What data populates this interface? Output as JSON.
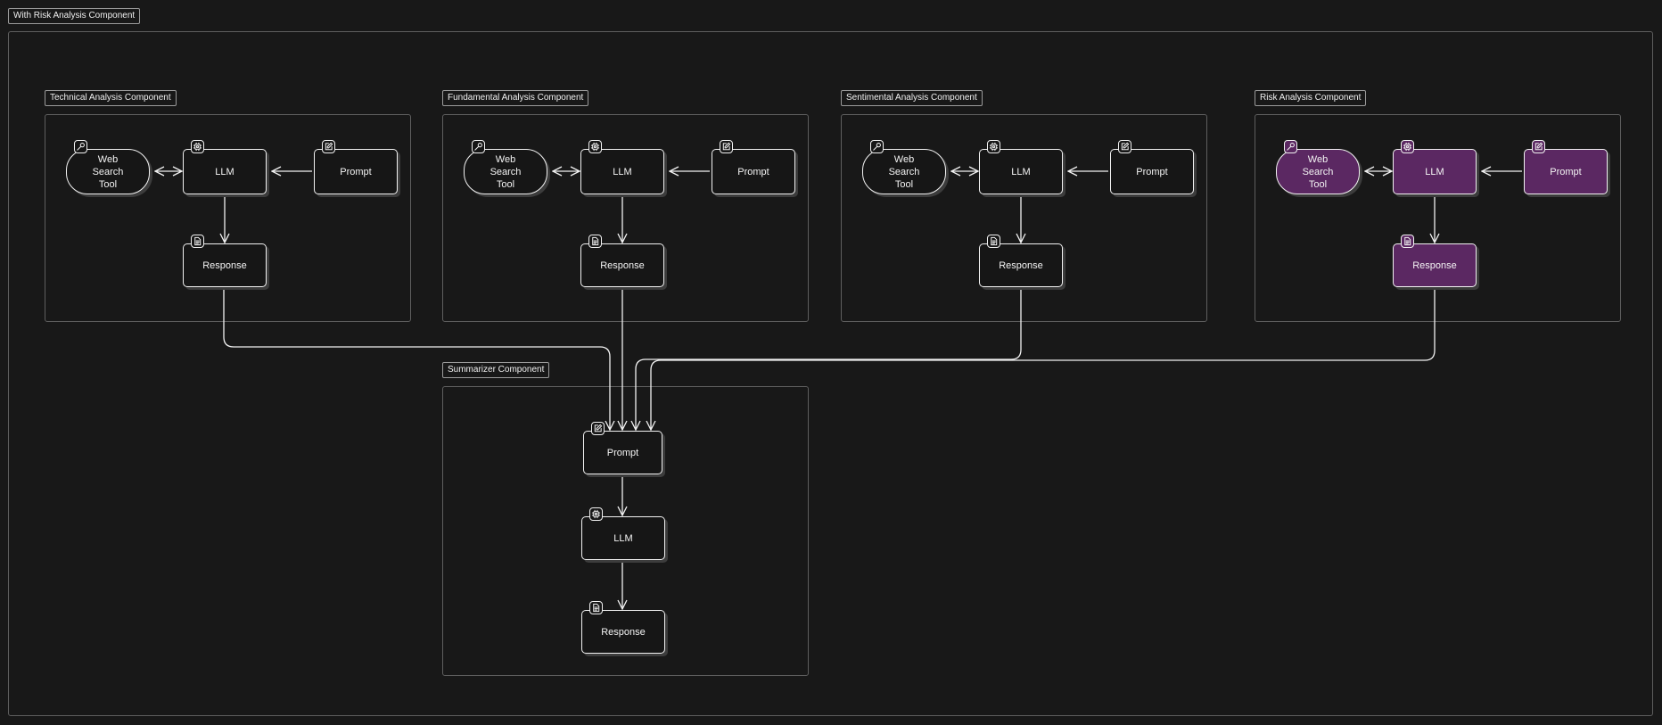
{
  "outer": {
    "label": "With Risk Analysis Component"
  },
  "components": [
    {
      "id": "technical",
      "label": "Technical Analysis Component",
      "highlight": false,
      "nodes": {
        "tool": "Web\nSearch\nTool",
        "llm": "LLM",
        "prompt": "Prompt",
        "response": "Response"
      }
    },
    {
      "id": "fundamental",
      "label": "Fundamental Analysis Component",
      "highlight": false,
      "nodes": {
        "tool": "Web\nSearch\nTool",
        "llm": "LLM",
        "prompt": "Prompt",
        "response": "Response"
      }
    },
    {
      "id": "sentimental",
      "label": "Sentimental Analysis Component",
      "highlight": false,
      "nodes": {
        "tool": "Web\nSearch\nTool",
        "llm": "LLM",
        "prompt": "Prompt",
        "response": "Response"
      }
    },
    {
      "id": "risk",
      "label": "Risk Analysis Component",
      "highlight": true,
      "nodes": {
        "tool": "Web\nSearch\nTool",
        "llm": "LLM",
        "prompt": "Prompt",
        "response": "Response"
      }
    }
  ],
  "summarizer": {
    "label": "Summarizer Component",
    "nodes": {
      "prompt": "Prompt",
      "llm": "LLM",
      "response": "Response"
    }
  },
  "icons": {
    "tool": "wrench-icon",
    "llm": "cpu-icon",
    "prompt": "edit-icon",
    "response": "document-icon"
  },
  "colors": {
    "background": "#181818",
    "highlight": "#5b2862",
    "stroke": "#f2f2f2"
  }
}
